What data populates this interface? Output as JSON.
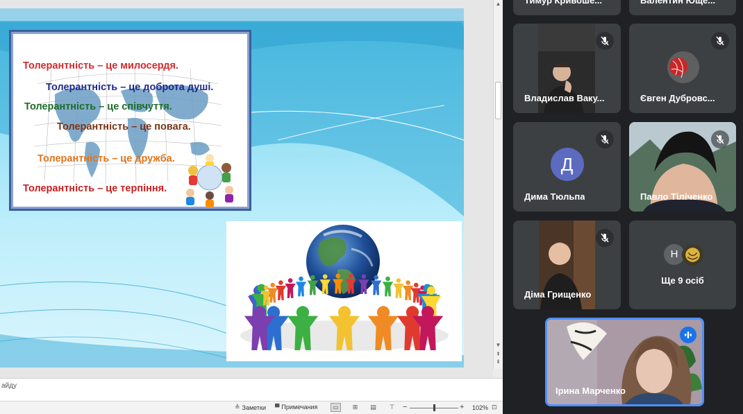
{
  "slide": {
    "tolerance_lines": [
      "Толерантність – це милосердя.",
      "Толерантність – це доброта душі.",
      "Толерантність – це співчуття.",
      "Толерантність – це повага.",
      "Толерантність – це дружба.",
      "Толерантність – це терпіння."
    ]
  },
  "notes": {
    "placeholder_fragment": "айду"
  },
  "statusbar": {
    "notes_label": "Заметки",
    "comments_label": "Примечания",
    "zoom_level": "102%",
    "zoom_fraction": 0.5
  },
  "participants": [
    {
      "name": "Тимур Кривоше...",
      "muted": false,
      "kind": "cut"
    },
    {
      "name": "Валентин Юще...",
      "muted": false,
      "kind": "cut"
    },
    {
      "name": "Владислав Ваку...",
      "muted": true,
      "kind": "video"
    },
    {
      "name": "Євген Дубровс...",
      "muted": true,
      "kind": "avatar-image"
    },
    {
      "name": "Дима Тюльпа",
      "muted": true,
      "kind": "letter",
      "letter": "Д",
      "color": "#5c6bc0"
    },
    {
      "name": "Павло Тіліченко",
      "muted": true,
      "kind": "video"
    },
    {
      "name": "Діма Грищенко",
      "muted": true,
      "kind": "video"
    },
    {
      "name": "Ще 9 осіб",
      "muted": false,
      "kind": "more",
      "letter": "Н",
      "color": "#5f6368"
    },
    {
      "name": "Ірина Марченко",
      "muted": false,
      "kind": "video-speaking"
    }
  ],
  "colors": {
    "tile_bg": "#3c4043",
    "panel_bg": "#202124",
    "speaking_border": "#4d90fe",
    "speaking_badge": "#1a73e8"
  },
  "icons": [
    "mic-off-icon",
    "speaking-icon",
    "scroll-up-icon",
    "scroll-down-icon",
    "notes-icon",
    "comments-icon",
    "normal-view-icon",
    "slide-sorter-icon",
    "reading-view-icon",
    "slideshow-icon",
    "zoom-out-icon",
    "zoom-in-icon",
    "fit-slide-icon"
  ]
}
